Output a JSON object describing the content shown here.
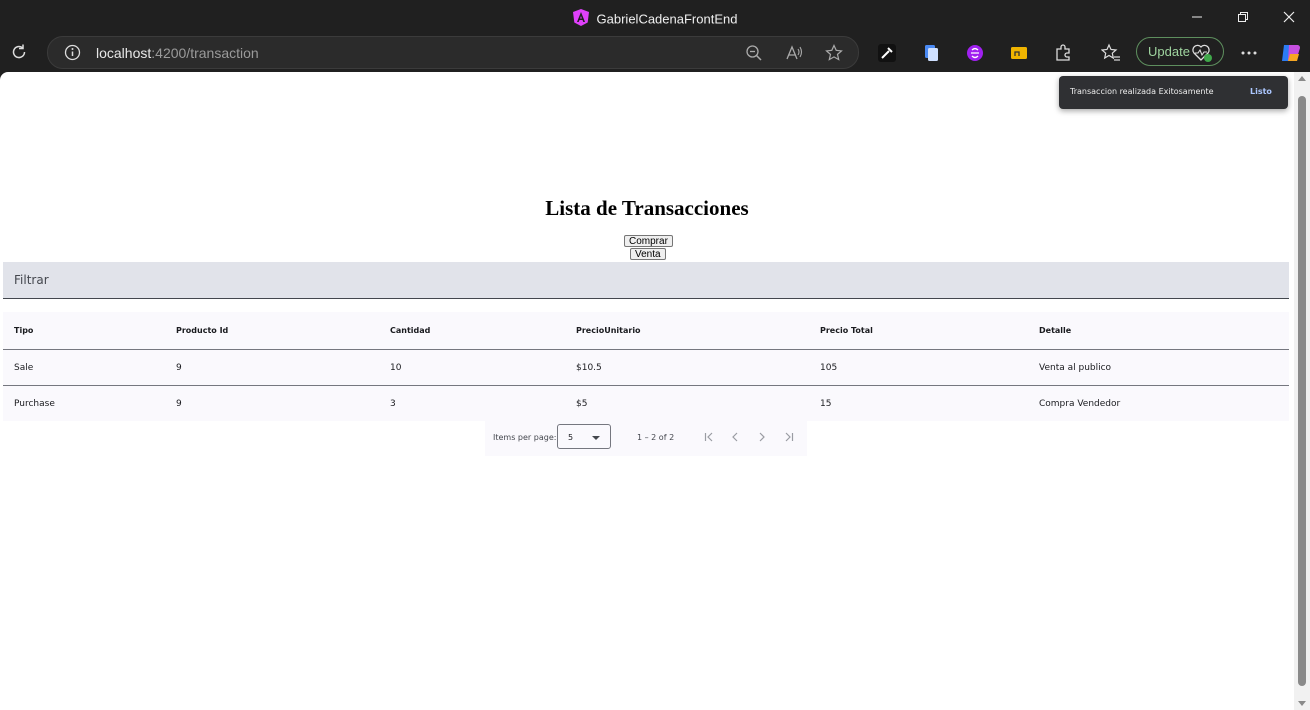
{
  "window": {
    "title": "GabrielCadenaFrontEnd"
  },
  "browser": {
    "url_host": "localhost",
    "url_path": ":4200/transaction",
    "update_label": "Update"
  },
  "page": {
    "heading": "Lista de Transacciones",
    "buy_button": "Comprar",
    "sell_button": "Venta",
    "filter_label": "Filtrar"
  },
  "table": {
    "headers": [
      "Tipo",
      "Producto Id",
      "Cantidad",
      "PrecioUnitario",
      "Precio Total",
      "Detalle"
    ],
    "rows": [
      [
        "Sale",
        "9",
        "10",
        "$10.5",
        "105",
        "Venta al publico"
      ],
      [
        "Purchase",
        "9",
        "3",
        "$5",
        "15",
        "Compra Vendedor"
      ]
    ]
  },
  "paginator": {
    "items_per_page_label": "Items per page:",
    "page_size": "5",
    "range_label": "1 – 2 of 2"
  },
  "snackbar": {
    "message": "Transaccion realizada Exitosamente",
    "action": "Listo"
  },
  "colors": {
    "browser_chrome": "#202020",
    "filter_bg": "#e1e3ea",
    "table_bg": "#faf9fd",
    "snackbar_bg": "#2f3033",
    "snackbar_action": "#acc7ff",
    "update_accent": "#9fd49f"
  }
}
